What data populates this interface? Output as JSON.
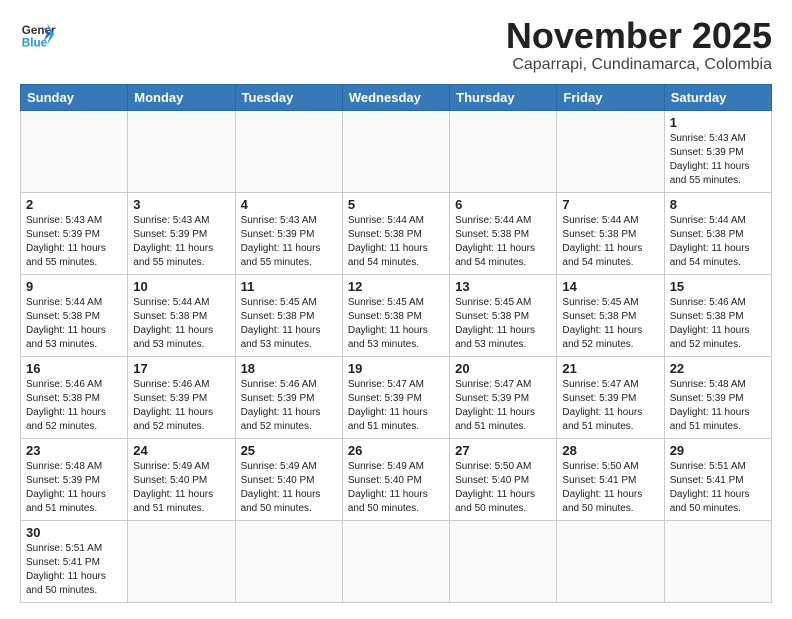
{
  "header": {
    "logo_general": "General",
    "logo_blue": "Blue",
    "month_title": "November 2025",
    "location": "Caparrapi, Cundinamarca, Colombia"
  },
  "days_of_week": [
    "Sunday",
    "Monday",
    "Tuesday",
    "Wednesday",
    "Thursday",
    "Friday",
    "Saturday"
  ],
  "weeks": [
    [
      {
        "day": null,
        "content": null
      },
      {
        "day": null,
        "content": null
      },
      {
        "day": null,
        "content": null
      },
      {
        "day": null,
        "content": null
      },
      {
        "day": null,
        "content": null
      },
      {
        "day": null,
        "content": null
      },
      {
        "day": "1",
        "content": "Sunrise: 5:43 AM\nSunset: 5:39 PM\nDaylight: 11 hours\nand 55 minutes."
      }
    ],
    [
      {
        "day": "2",
        "content": "Sunrise: 5:43 AM\nSunset: 5:39 PM\nDaylight: 11 hours\nand 55 minutes."
      },
      {
        "day": "3",
        "content": "Sunrise: 5:43 AM\nSunset: 5:39 PM\nDaylight: 11 hours\nand 55 minutes."
      },
      {
        "day": "4",
        "content": "Sunrise: 5:43 AM\nSunset: 5:39 PM\nDaylight: 11 hours\nand 55 minutes."
      },
      {
        "day": "5",
        "content": "Sunrise: 5:44 AM\nSunset: 5:38 PM\nDaylight: 11 hours\nand 54 minutes."
      },
      {
        "day": "6",
        "content": "Sunrise: 5:44 AM\nSunset: 5:38 PM\nDaylight: 11 hours\nand 54 minutes."
      },
      {
        "day": "7",
        "content": "Sunrise: 5:44 AM\nSunset: 5:38 PM\nDaylight: 11 hours\nand 54 minutes."
      },
      {
        "day": "8",
        "content": "Sunrise: 5:44 AM\nSunset: 5:38 PM\nDaylight: 11 hours\nand 54 minutes."
      }
    ],
    [
      {
        "day": "9",
        "content": "Sunrise: 5:44 AM\nSunset: 5:38 PM\nDaylight: 11 hours\nand 53 minutes."
      },
      {
        "day": "10",
        "content": "Sunrise: 5:44 AM\nSunset: 5:38 PM\nDaylight: 11 hours\nand 53 minutes."
      },
      {
        "day": "11",
        "content": "Sunrise: 5:45 AM\nSunset: 5:38 PM\nDaylight: 11 hours\nand 53 minutes."
      },
      {
        "day": "12",
        "content": "Sunrise: 5:45 AM\nSunset: 5:38 PM\nDaylight: 11 hours\nand 53 minutes."
      },
      {
        "day": "13",
        "content": "Sunrise: 5:45 AM\nSunset: 5:38 PM\nDaylight: 11 hours\nand 53 minutes."
      },
      {
        "day": "14",
        "content": "Sunrise: 5:45 AM\nSunset: 5:38 PM\nDaylight: 11 hours\nand 52 minutes."
      },
      {
        "day": "15",
        "content": "Sunrise: 5:46 AM\nSunset: 5:38 PM\nDaylight: 11 hours\nand 52 minutes."
      }
    ],
    [
      {
        "day": "16",
        "content": "Sunrise: 5:46 AM\nSunset: 5:38 PM\nDaylight: 11 hours\nand 52 minutes."
      },
      {
        "day": "17",
        "content": "Sunrise: 5:46 AM\nSunset: 5:39 PM\nDaylight: 11 hours\nand 52 minutes."
      },
      {
        "day": "18",
        "content": "Sunrise: 5:46 AM\nSunset: 5:39 PM\nDaylight: 11 hours\nand 52 minutes."
      },
      {
        "day": "19",
        "content": "Sunrise: 5:47 AM\nSunset: 5:39 PM\nDaylight: 11 hours\nand 51 minutes."
      },
      {
        "day": "20",
        "content": "Sunrise: 5:47 AM\nSunset: 5:39 PM\nDaylight: 11 hours\nand 51 minutes."
      },
      {
        "day": "21",
        "content": "Sunrise: 5:47 AM\nSunset: 5:39 PM\nDaylight: 11 hours\nand 51 minutes."
      },
      {
        "day": "22",
        "content": "Sunrise: 5:48 AM\nSunset: 5:39 PM\nDaylight: 11 hours\nand 51 minutes."
      }
    ],
    [
      {
        "day": "23",
        "content": "Sunrise: 5:48 AM\nSunset: 5:39 PM\nDaylight: 11 hours\nand 51 minutes."
      },
      {
        "day": "24",
        "content": "Sunrise: 5:49 AM\nSunset: 5:40 PM\nDaylight: 11 hours\nand 51 minutes."
      },
      {
        "day": "25",
        "content": "Sunrise: 5:49 AM\nSunset: 5:40 PM\nDaylight: 11 hours\nand 50 minutes."
      },
      {
        "day": "26",
        "content": "Sunrise: 5:49 AM\nSunset: 5:40 PM\nDaylight: 11 hours\nand 50 minutes."
      },
      {
        "day": "27",
        "content": "Sunrise: 5:50 AM\nSunset: 5:40 PM\nDaylight: 11 hours\nand 50 minutes."
      },
      {
        "day": "28",
        "content": "Sunrise: 5:50 AM\nSunset: 5:41 PM\nDaylight: 11 hours\nand 50 minutes."
      },
      {
        "day": "29",
        "content": "Sunrise: 5:51 AM\nSunset: 5:41 PM\nDaylight: 11 hours\nand 50 minutes."
      }
    ],
    [
      {
        "day": "30",
        "content": "Sunrise: 5:51 AM\nSunset: 5:41 PM\nDaylight: 11 hours\nand 50 minutes."
      },
      {
        "day": null,
        "content": null
      },
      {
        "day": null,
        "content": null
      },
      {
        "day": null,
        "content": null
      },
      {
        "day": null,
        "content": null
      },
      {
        "day": null,
        "content": null
      },
      {
        "day": null,
        "content": null
      }
    ]
  ]
}
